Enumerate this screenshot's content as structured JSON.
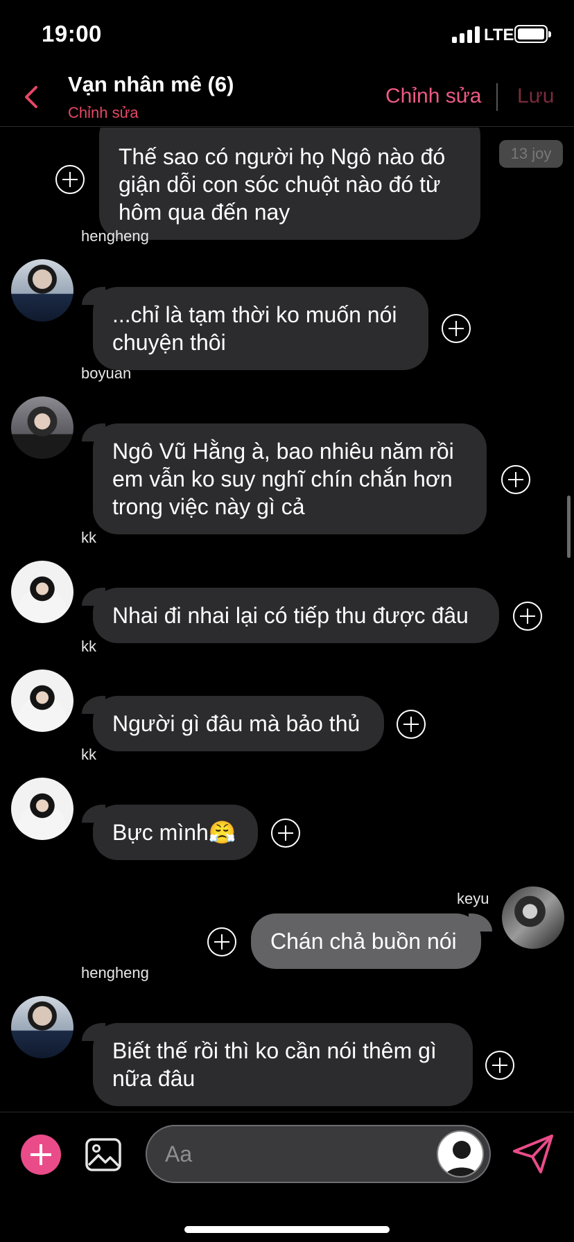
{
  "status_bar": {
    "time": "19:00",
    "network": "LTE"
  },
  "header": {
    "title": "Vạn nhân mê (6)",
    "subtitle": "Chỉnh sửa",
    "edit_label": "Chỉnh sửa",
    "save_label": "Lưu",
    "accent_color": "#ee5a84"
  },
  "messages": [
    {
      "sender": "",
      "text": "Thế sao có người họ Ngô nào đó giận dỗi con sóc chuột nào đó từ hôm qua đến nay",
      "own": false
    },
    {
      "sender": "hengheng",
      "text": "...chỉ là tạm thời ko muốn nói chuyện thôi",
      "own": false
    },
    {
      "sender": "boyuan",
      "text": "Ngô Vũ Hằng à, bao nhiêu năm rồi em vẫn ko suy nghĩ chín chắn hơn trong việc này gì cả",
      "own": false
    },
    {
      "sender": "kk",
      "text": "Nhai đi nhai lại có tiếp thu được đâu",
      "own": false
    },
    {
      "sender": "kk",
      "text": "Người gì đâu mà bảo thủ",
      "own": false
    },
    {
      "sender": "kk",
      "text": "Bực mình😤",
      "own": false
    },
    {
      "sender": "keyu",
      "text": "Chán chả buồn nói",
      "own": true
    },
    {
      "sender": "hengheng",
      "text": "Biết thế rồi thì ko cần nói thêm gì nữa đâu",
      "own": false
    }
  ],
  "peek_badge": "13 joy",
  "composer": {
    "placeholder": "Aa"
  },
  "icons": {
    "back": "chevron-left-icon",
    "add": "plus-icon",
    "image": "image-icon",
    "send": "send-icon"
  }
}
